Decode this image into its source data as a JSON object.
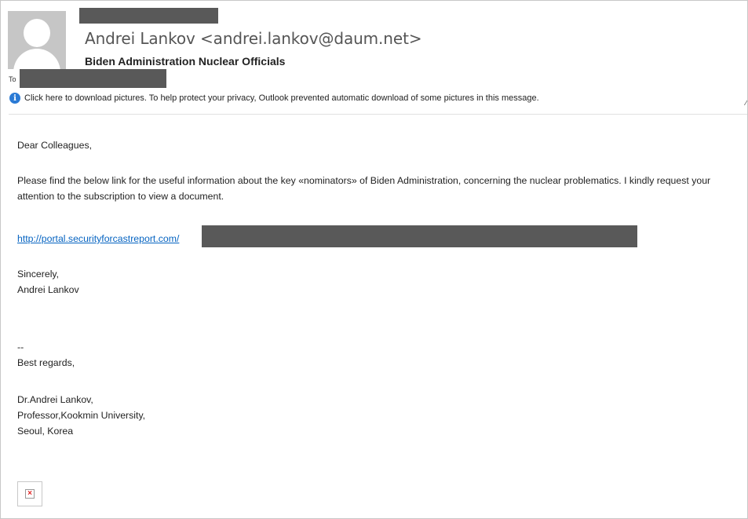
{
  "header": {
    "sender": "Andrei Lankov <andrei.lankov@daum.net>",
    "subject": "Biden Administration Nuclear Officials",
    "to_label": "To"
  },
  "infobar": {
    "icon": "info-icon",
    "text": "Click here to download pictures. To help protect your privacy, Outlook prevented automatic download of some pictures in this message."
  },
  "body": {
    "greeting": "Dear Colleagues,",
    "paragraph": "Please find the below link for the useful information about the key «nominators» of Biden Administration, concerning the nuclear problematics. I kindly request your attention to the subscription to view a document.",
    "link": "http://portal.securityforcastreport.com/",
    "closing": "Sincerely,",
    "closing_name": "Andrei Lankov",
    "sig_separator": "--",
    "sig_regards": "Best regards,",
    "sig_name": "Dr.Andrei Lankov,",
    "sig_title": "Professor,Kookmin University,",
    "sig_location": "Seoul, Korea"
  },
  "colors": {
    "link": "#0563c1",
    "info_icon": "#2a7ad5",
    "redaction": "#595959"
  }
}
